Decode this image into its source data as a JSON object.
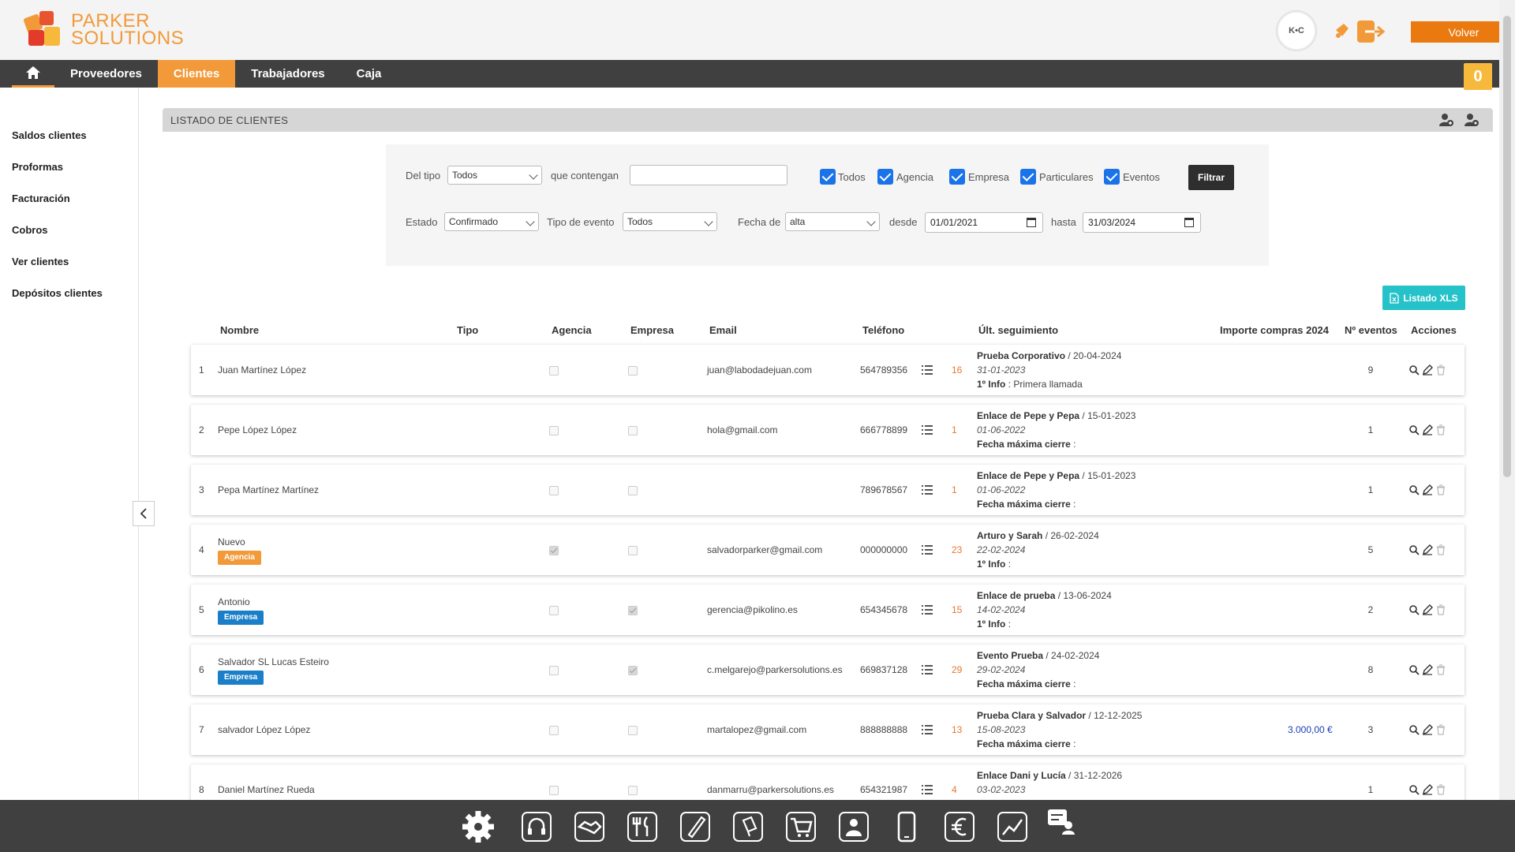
{
  "brand": {
    "line1": "PARKER",
    "line2": "SOLUTIONS",
    "color": "#f29a3a"
  },
  "header": {
    "avatar_label": "K•C",
    "volver_label": "Volver"
  },
  "nav": {
    "items": [
      {
        "label": "Proveedores",
        "active": false
      },
      {
        "label": "Clientes",
        "active": true
      },
      {
        "label": "Trabajadores",
        "active": false
      },
      {
        "label": "Caja",
        "active": false
      }
    ],
    "cart_count": "0"
  },
  "sidebar": {
    "items": [
      {
        "label": "Saldos clientes"
      },
      {
        "label": "Proformas"
      },
      {
        "label": "Facturación"
      },
      {
        "label": "Cobros"
      },
      {
        "label": "Ver clientes"
      },
      {
        "label": "Depósitos clientes"
      }
    ]
  },
  "panel": {
    "title": "LISTADO DE CLIENTES"
  },
  "filters": {
    "del_tipo_label": "Del tipo",
    "del_tipo_value": "Todos",
    "que_contengan_label": "que contengan",
    "que_contengan_value": "",
    "checkboxes": [
      {
        "label": "Todos",
        "checked": true
      },
      {
        "label": "Agencia",
        "checked": true
      },
      {
        "label": "Empresa",
        "checked": true
      },
      {
        "label": "Particulares",
        "checked": true
      },
      {
        "label": "Eventos",
        "checked": true
      }
    ],
    "filtrar_label": "Filtrar",
    "estado_label": "Estado",
    "estado_value": "Confirmado",
    "tipo_evento_label": "Tipo de evento",
    "tipo_evento_value": "Todos",
    "fecha_de_label": "Fecha de",
    "fecha_de_value": "alta",
    "desde_label": "desde",
    "desde_value": "01/01/2021",
    "hasta_label": "hasta",
    "hasta_value": "31/03/2024"
  },
  "xls_label": "Listado XLS",
  "table": {
    "headers": {
      "nombre": "Nombre",
      "tipo": "Tipo",
      "agencia": "Agencia",
      "empresa": "Empresa",
      "email": "Email",
      "telefono": "Teléfono",
      "ult_seguimiento": "Últ. seguimiento",
      "importe": "Importe compras 2024",
      "neventos": "Nº eventos",
      "acciones": "Acciones"
    },
    "rows": [
      {
        "num": "1",
        "name": "Juan Martínez López",
        "badge": "",
        "agencia": false,
        "empresa": false,
        "email": "juan@labodadejuan.com",
        "phone": "564789356",
        "count": "16",
        "seg_title": "Prueba Corporativo",
        "seg_date": " / 20-04-2024",
        "seg_italic": "31-01-2023",
        "seg_label": "1º Info",
        "seg_value": " : Primera llamada",
        "importe": "",
        "neventos": "9"
      },
      {
        "num": "2",
        "name": "Pepe López López",
        "badge": "",
        "agencia": false,
        "empresa": false,
        "email": "hola@gmail.com",
        "phone": "666778899",
        "count": "1",
        "seg_title": "Enlace de Pepe y Pepa",
        "seg_date": " / 15-01-2023",
        "seg_italic": "01-06-2022",
        "seg_label": "Fecha máxima cierre",
        "seg_value": " :",
        "importe": "",
        "neventos": "1"
      },
      {
        "num": "3",
        "name": "Pepa Martínez Martínez",
        "badge": "",
        "agencia": false,
        "empresa": false,
        "email": "",
        "phone": "789678567",
        "count": "1",
        "seg_title": "Enlace de Pepe y Pepa",
        "seg_date": " / 15-01-2023",
        "seg_italic": "01-06-2022",
        "seg_label": "Fecha máxima cierre",
        "seg_value": " :",
        "importe": "",
        "neventos": "1"
      },
      {
        "num": "4",
        "name": "Nuevo",
        "badge": "Agencia",
        "badge_type": "agencia",
        "agencia": true,
        "empresa": false,
        "email": "salvadorparker@gmail.com",
        "phone": "000000000",
        "count": "23",
        "seg_title": "Arturo y Sarah",
        "seg_date": " / 26-02-2024",
        "seg_italic": "22-02-2024",
        "seg_label": "1º Info",
        "seg_value": " :",
        "importe": "",
        "neventos": "5"
      },
      {
        "num": "5",
        "name": "Antonio",
        "badge": "Empresa",
        "badge_type": "empresa",
        "agencia": false,
        "empresa": true,
        "email": "gerencia@pikolino.es",
        "phone": "654345678",
        "count": "15",
        "seg_title": "Enlace de prueba",
        "seg_date": " / 13-06-2024",
        "seg_italic": "14-02-2024",
        "seg_label": "1º Info",
        "seg_value": " :",
        "importe": "",
        "neventos": "2"
      },
      {
        "num": "6",
        "name": "Salvador SL Lucas Esteiro",
        "badge": "Empresa",
        "badge_type": "empresa",
        "agencia": false,
        "empresa": true,
        "email": "c.melgarejo@parkersolutions.es",
        "phone": "669837128",
        "count": "29",
        "seg_title": "Evento Prueba",
        "seg_date": " / 24-02-2024",
        "seg_italic": "29-02-2024",
        "seg_label": "Fecha máxima cierre",
        "seg_value": " :",
        "importe": "",
        "neventos": "8"
      },
      {
        "num": "7",
        "name": "salvador López López",
        "badge": "",
        "agencia": false,
        "empresa": false,
        "email": "martalopez@gmail.com",
        "phone": "888888888",
        "count": "13",
        "seg_title": "Prueba Clara y Salvador",
        "seg_date": " / 12-12-2025",
        "seg_italic": "15-08-2023",
        "seg_label": "Fecha máxima cierre",
        "seg_value": " :",
        "importe": "3.000,00 €",
        "neventos": "3"
      },
      {
        "num": "8",
        "name": "Daniel Martínez Rueda",
        "badge": "",
        "agencia": false,
        "empresa": false,
        "email": "danmarru@parkersolutions.es",
        "phone": "654321987",
        "count": "4",
        "seg_title": "Enlace Dani y Lucía",
        "seg_date": " / 31-12-2026",
        "seg_italic": "03-02-2023",
        "seg_label": "",
        "seg_value": "",
        "importe": "",
        "neventos": "1"
      }
    ]
  },
  "bottom_toolbar": {
    "icons": [
      "gear-icon",
      "headset-icon",
      "handshake-icon",
      "cutlery-icon",
      "pen-icon",
      "marker-icon",
      "cart-icon",
      "contacts-icon",
      "mobile-icon",
      "euro-icon",
      "chart-icon",
      "feedback-icon"
    ]
  }
}
